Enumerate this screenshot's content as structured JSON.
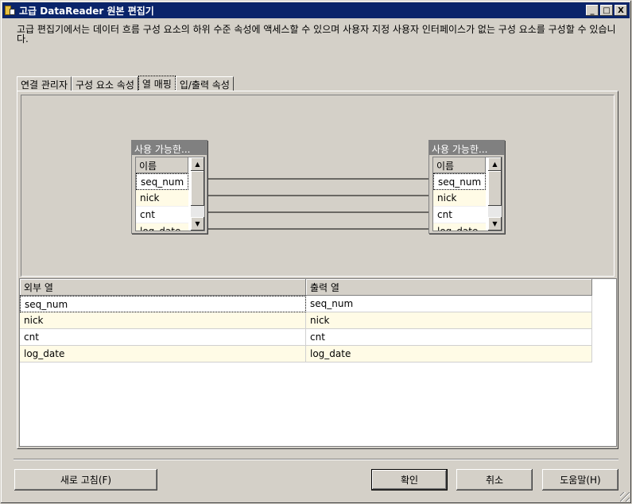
{
  "window": {
    "title": "고급 DataReader 원본 편집기",
    "min_label": "_",
    "max_label": "□",
    "close_label": "X"
  },
  "description": "고급 편집기에서는 데이터 흐름 구성 요소의 하위 수준 속성에 액세스할 수 있으며 사용자 지정 사용자 인터페이스가 없는 구성 요소를 구성할 수 있습니다.",
  "tabs": [
    {
      "label": "연결 관리자"
    },
    {
      "label": "구성 요소 속성"
    },
    {
      "label": "열 매핑"
    },
    {
      "label": "입/출력 속성"
    }
  ],
  "mapping": {
    "left_box": {
      "title": "사용 가능한...",
      "header": "이름",
      "items": [
        "seq_num",
        "nick",
        "cnt",
        "log_date"
      ]
    },
    "right_box": {
      "title": "사용 가능한...",
      "header": "이름",
      "items": [
        "seq_num",
        "nick",
        "cnt",
        "log_date"
      ]
    }
  },
  "grid": {
    "columns": [
      "외부 열",
      "출력 열"
    ],
    "rows": [
      [
        "seq_num",
        "seq_num"
      ],
      [
        "nick",
        "nick"
      ],
      [
        "cnt",
        "cnt"
      ],
      [
        "log_date",
        "log_date"
      ]
    ]
  },
  "buttons": {
    "refresh": "새로 고침(F)",
    "ok": "확인",
    "cancel": "취소",
    "help": "도움말(H)"
  },
  "icons": {
    "scroll_up": "▲",
    "scroll_down": "▼"
  }
}
